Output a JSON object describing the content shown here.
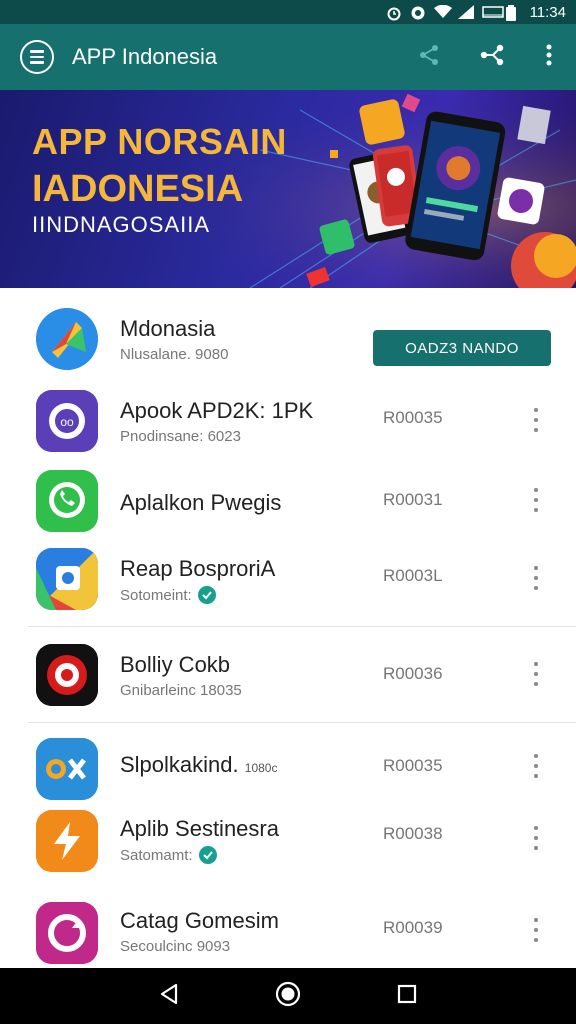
{
  "status_bar": {
    "time": "11:34"
  },
  "app_bar": {
    "title": "APP Indonesia",
    "icons": [
      "menu-icon",
      "share-icon",
      "connect-icon",
      "more-vert-icon"
    ]
  },
  "banner": {
    "line1": "APP NORSAIN",
    "line2": "IADONESIA",
    "line3": "IINDNAGOSAIIA"
  },
  "items": [
    {
      "name": "Mdonasia",
      "sub": "Nlusalane. 9080",
      "action": "OADZ3 NANDO",
      "icon": "maps-icon",
      "color": "#2b8ee6"
    },
    {
      "name": "Apook APD2K: 1PK",
      "sub": "Pnodinsane: 6023",
      "code": "R00035",
      "icon": "chat-icon",
      "color": "#5b3fb8"
    },
    {
      "name": "Aplalkon Pwegis",
      "sub": "",
      "code": "R00031",
      "icon": "phone-icon",
      "color": "#2fbf4a"
    },
    {
      "name": "Reap BosproriA",
      "sub": "Sotomeint:",
      "verified": true,
      "code": "R0003L",
      "icon": "camera-icon",
      "color": "#2a7ee0"
    },
    {
      "name": "Bolliy Cokb",
      "sub": "Gnibarleinc 18035",
      "code": "R00036",
      "icon": "eye-icon",
      "color": "#d61b1b"
    },
    {
      "name": "Slpolkakind.",
      "sub_small": "1080c",
      "sub": "",
      "code": "R00035",
      "icon": "ox-icon",
      "color": "#2a8ed8"
    },
    {
      "name": "Aplib Sestinesra",
      "sub": "Satomamt:",
      "verified": true,
      "code": "R00038",
      "icon": "bolt-icon",
      "color": "#f18a18"
    },
    {
      "name": "Catag Gomesim",
      "sub": "Secoulcinc 9093",
      "code": "R00039",
      "icon": "sync-icon",
      "color": "#c0288a"
    }
  ],
  "nav": {
    "icons": [
      "back-icon",
      "home-icon",
      "recents-icon"
    ]
  }
}
